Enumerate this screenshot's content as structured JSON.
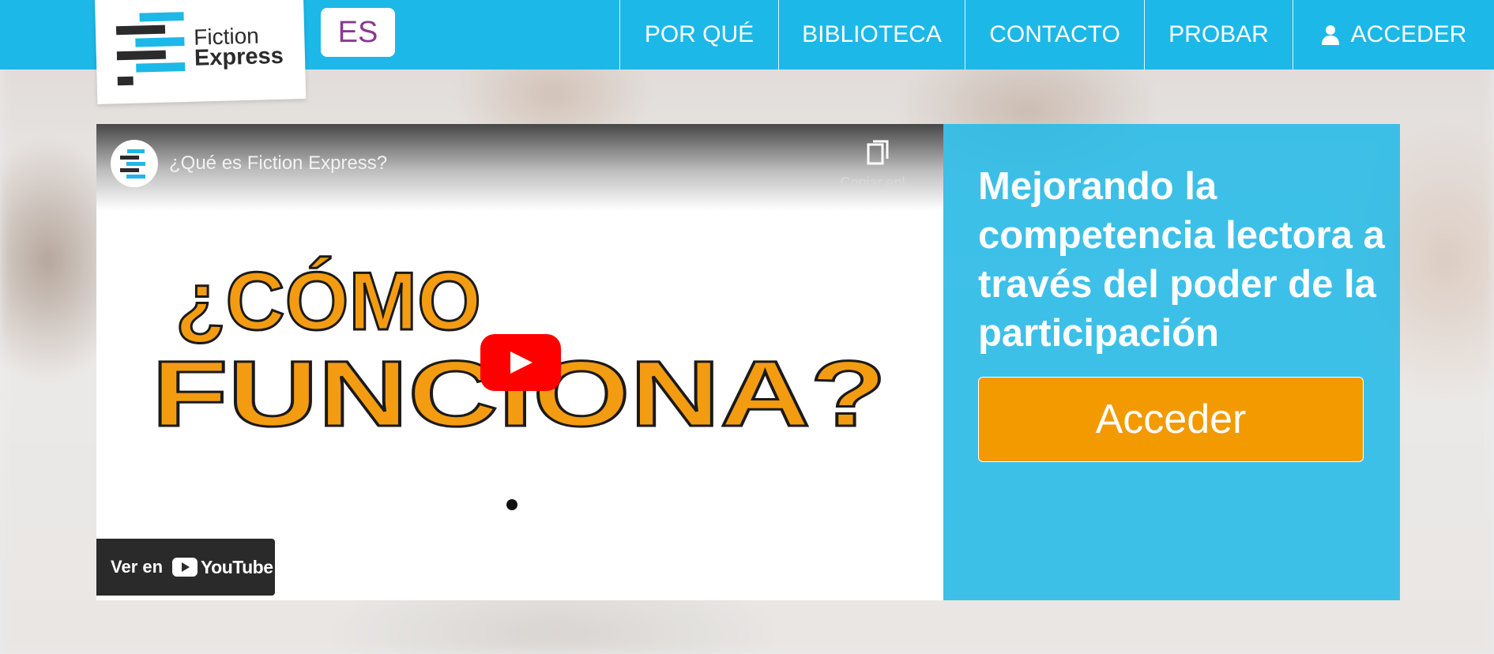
{
  "brand": {
    "name_line1": "Fiction",
    "name_line2": "Express",
    "colors": {
      "primary": "#1cb8e8",
      "accent": "#f29a00",
      "dark": "#2b2b2b",
      "language": "#8a3a8f"
    }
  },
  "header": {
    "language": "ES",
    "nav": [
      {
        "label": "POR QUÉ"
      },
      {
        "label": "BIBLIOTECA"
      },
      {
        "label": "CONTACTO"
      },
      {
        "label": "PROBAR"
      },
      {
        "label": "ACCEDER",
        "icon": "user-icon"
      }
    ]
  },
  "video": {
    "title": "¿Qué es Fiction Express?",
    "copy_link_label": "Copiar enl...",
    "graphic_text": {
      "line1": "¿CÓMO",
      "line2": "FUNCIONA?"
    },
    "watch_on_label": "Ver en",
    "youtube_label": "YouTube",
    "icons": [
      "copy-icon",
      "play-icon",
      "youtube-icon"
    ]
  },
  "hero": {
    "headline": "Mejorando la competencia lectora a través del poder de la participación",
    "cta_label": "Acceder"
  }
}
